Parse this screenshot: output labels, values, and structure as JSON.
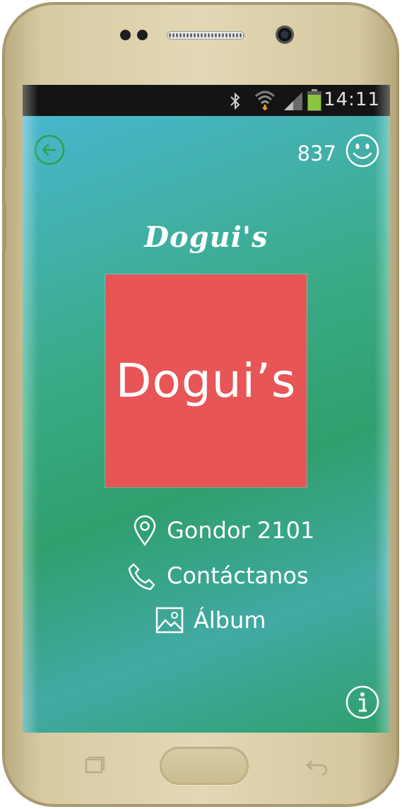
{
  "status_bar": {
    "time": "14:11",
    "icons": [
      "bluetooth-icon",
      "wifi-icon",
      "signal-icon",
      "battery-icon"
    ]
  },
  "header": {
    "back_icon": "arrow-left-circle-icon",
    "score": "837",
    "smiley_icon": "smiley-icon"
  },
  "brand": {
    "title": "Dogui's",
    "logo_text": "Dogui’s",
    "logo_color": "#e85556"
  },
  "info": {
    "address": "Gondor 2101",
    "contact": "Contáctanos",
    "album": "Álbum"
  },
  "footer": {
    "info_icon": "info-circle-icon"
  },
  "colors": {
    "accent_green": "#2e9f4f",
    "gradient_top": "#4bb8d6",
    "gradient_mid": "#2f9f6d"
  }
}
